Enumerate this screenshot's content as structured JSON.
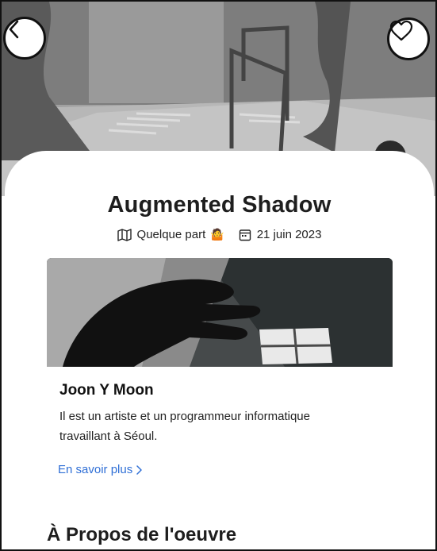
{
  "hero": {
    "back_icon": "chevron-left-icon",
    "favorite_icon": "heart-outline-icon"
  },
  "artwork": {
    "title": "Augmented Shadow",
    "location": "Quelque part",
    "location_emoji": "🤷",
    "date": "21 juin 2023",
    "location_icon": "map-icon",
    "date_icon": "calendar-icon"
  },
  "artist": {
    "name": "Joon Y Moon",
    "bio": "Il est un artiste et un programmeur informatique travaillant à Séoul.",
    "more_label": "En savoir plus",
    "more_icon": "chevron-right-icon"
  },
  "section": {
    "about_title": "À Propos de l'oeuvre"
  },
  "colors": {
    "link": "#2f6fd6",
    "text": "#1e1e1e"
  }
}
